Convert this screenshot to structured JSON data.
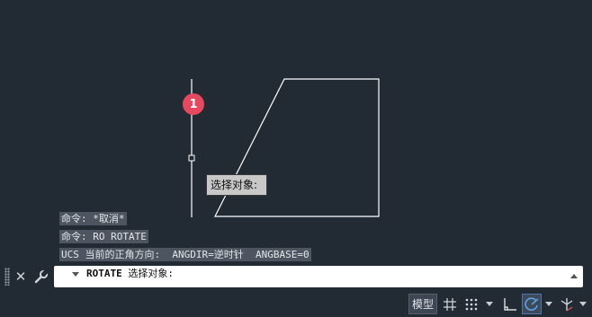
{
  "marker": {
    "label": "1"
  },
  "tooltip": {
    "text": "选择对象:"
  },
  "history": [
    {
      "text": "命令: *取消*"
    },
    {
      "text": "命令: RO ROTATE"
    },
    {
      "text": "UCS 当前的正角方向:  ANGDIR=逆时针  ANGBASE=0"
    }
  ],
  "command_line": {
    "command": "ROTATE",
    "prompt": " 选择对象:"
  },
  "status_bar": {
    "model_label": "模型"
  },
  "colors": {
    "background": "#222a34",
    "geometry": "#ffffff",
    "marker": "#e8485e",
    "tooltip_bg": "#c8c8c8",
    "active_blue": "#5da0e8"
  }
}
